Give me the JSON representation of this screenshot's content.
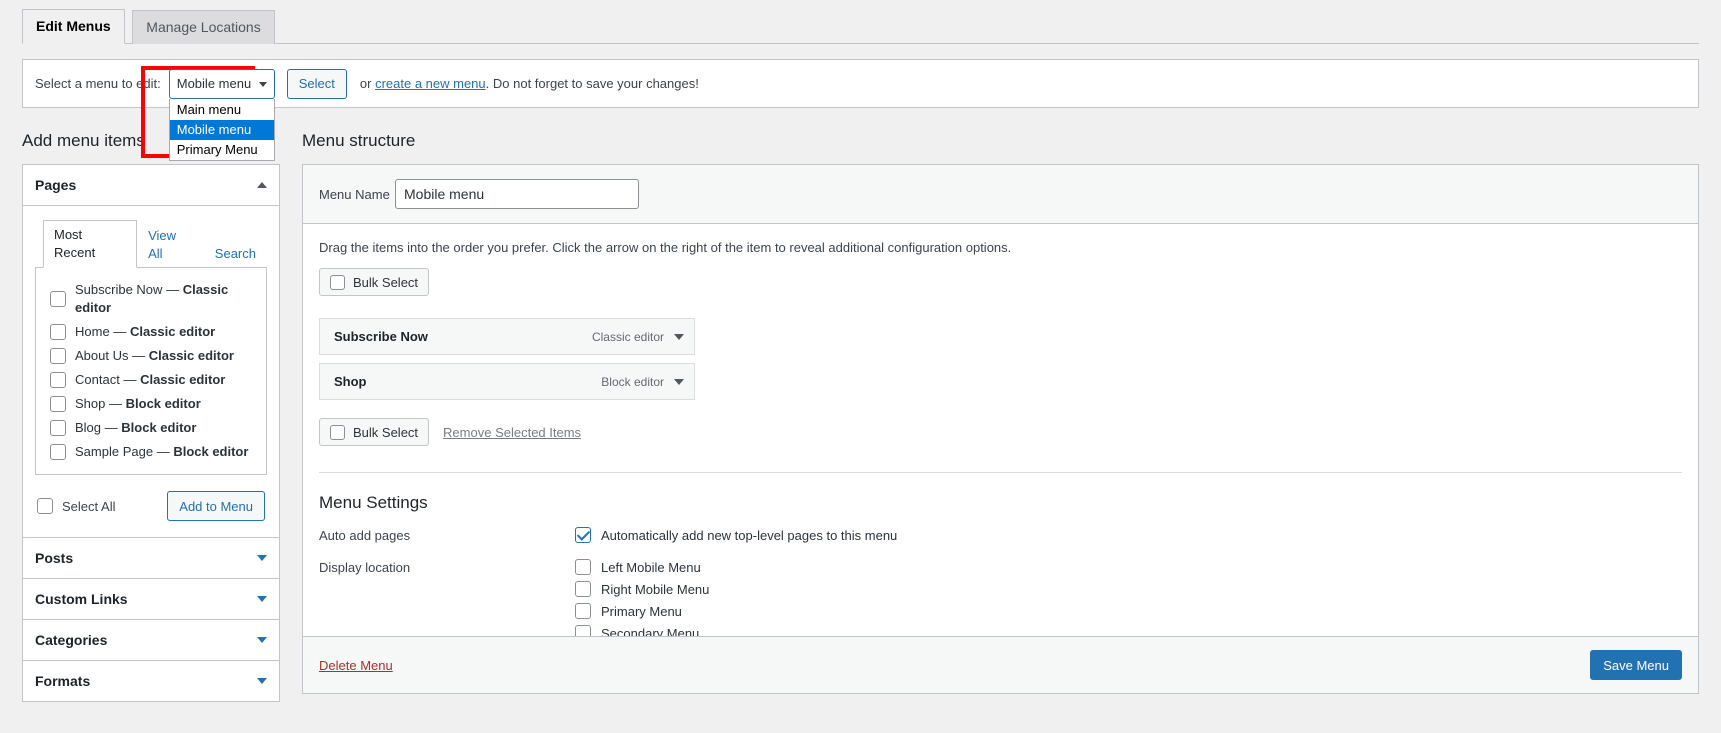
{
  "tabs": [
    {
      "label": "Edit Menus",
      "active": true
    },
    {
      "label": "Manage Locations",
      "active": false
    }
  ],
  "select_bar": {
    "label": "Select a menu to edit:",
    "current_value": "Mobile menu",
    "options": [
      "Main menu",
      "Mobile menu",
      "Primary Menu"
    ],
    "selected_option": "Mobile menu",
    "select_button": "Select",
    "or_text": "or",
    "create_link": "create a new menu",
    "tail_text": ". Do not forget to save your changes!",
    "highlight_color": "#ff0000"
  },
  "left": {
    "heading": "Add menu items",
    "pages_panel": {
      "title": "Pages",
      "tabs": [
        {
          "label": "Most Recent",
          "active": true
        },
        {
          "label": "View All",
          "active": false
        },
        {
          "label": "Search",
          "active": false
        }
      ],
      "items": [
        {
          "name": "Subscribe Now",
          "dash": "—",
          "editor": "Classic editor",
          "checked": false
        },
        {
          "name": "Home",
          "dash": "—",
          "editor": "Classic editor",
          "checked": false
        },
        {
          "name": "About Us",
          "dash": "—",
          "editor": "Classic editor",
          "checked": false
        },
        {
          "name": "Contact",
          "dash": "—",
          "editor": "Classic editor",
          "checked": false
        },
        {
          "name": "Shop",
          "dash": "—",
          "editor": "Block editor",
          "checked": false
        },
        {
          "name": "Blog",
          "dash": "—",
          "editor": "Block editor",
          "checked": false
        },
        {
          "name": "Sample Page",
          "dash": "—",
          "editor": "Block editor",
          "checked": false
        }
      ],
      "select_all_label": "Select All",
      "add_to_menu_label": "Add to Menu"
    },
    "collapsed_panels": [
      {
        "title": "Posts"
      },
      {
        "title": "Custom Links"
      },
      {
        "title": "Categories"
      },
      {
        "title": "Formats"
      }
    ]
  },
  "right": {
    "heading": "Menu structure",
    "menu_name_label": "Menu Name",
    "menu_name_value": "Mobile menu",
    "help_text": "Drag the items into the order you prefer. Click the arrow on the right of the item to reveal additional configuration options.",
    "bulk_select_label": "Bulk Select",
    "bulk_select_label_2": "Bulk Select",
    "remove_selected_label": "Remove Selected Items",
    "menu_items": [
      {
        "title": "Subscribe Now",
        "type": "Classic editor"
      },
      {
        "title": "Shop",
        "type": "Block editor"
      }
    ],
    "settings": {
      "title": "Menu Settings",
      "auto_add_label": "Auto add pages",
      "auto_add_option": "Automatically add new top-level pages to this menu",
      "auto_add_checked": true,
      "display_location_label": "Display location",
      "locations": [
        {
          "label": "Left Mobile Menu",
          "checked": false
        },
        {
          "label": "Right Mobile Menu",
          "checked": false
        },
        {
          "label": "Primary Menu",
          "checked": false
        },
        {
          "label": "Secondary Menu",
          "checked": false
        }
      ]
    },
    "footer": {
      "delete_label": "Delete Menu",
      "save_label": "Save Menu"
    }
  }
}
